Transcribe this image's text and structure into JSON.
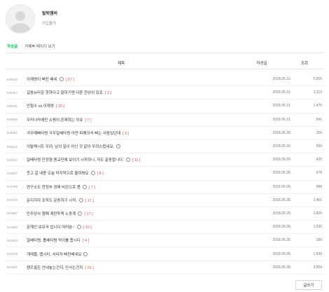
{
  "profile": {
    "name": "탈퇴멤버",
    "status": "가입불가"
  },
  "tabs": [
    {
      "label": "작성글",
      "active": true
    },
    {
      "label": "카페북 페이지 보기",
      "active": false
    }
  ],
  "table": {
    "headers": {
      "title": "제목",
      "date": "작성일",
      "views": "조회"
    },
    "rows": [
      {
        "num": "545612",
        "title": "이재명이 삐진 쎄네",
        "comments": "[ 27 ]",
        "emoji": true,
        "date": "2018.05.31.",
        "views": "5,655"
      },
      {
        "num": "545407",
        "title": "길음뉴타운 핫하다고 말하기엔 다른 현상이 있죠",
        "comments": "[ 3 ]",
        "emoji": false,
        "date": "2018.05.31.",
        "views": "2,113"
      },
      {
        "num": "545231",
        "title": "안철수 vs 이재명",
        "comments": "[ 20 ]",
        "emoji": false,
        "date": "2018.05.31.",
        "views": "1,475"
      },
      {
        "num": "544916",
        "title": "우리나라에만 쇼핑이 존재하는 이유",
        "comments": "[ 7 ]",
        "emoji": false,
        "date": "2018.05.31.",
        "views": "541"
      },
      {
        "num": "544451",
        "title": "극우메빠타령 극우일베타령 어떤 피해의식 삐는 사람있던데",
        "comments": "[ 5 ]",
        "emoji": false,
        "date": "2018.05.30.",
        "views": "156"
      },
      {
        "num": "544112",
        "title": "이탈렉시트 우려, 남의 일이 아닌 것 같아 우려스럽네요.",
        "comments": "",
        "emoji": true,
        "date": "2018.05.30.",
        "views": "599"
      },
      {
        "num": "542167",
        "title": "일베타령 단정형 종교단체 보이기 시작하니, 저도 출동합니다.",
        "comments": "[ 11 ]",
        "emoji": true,
        "date": "2018.05.29.",
        "views": "439"
      },
      {
        "num": "541827",
        "title": "웃고 갈 내용 오늘 마지막으로 올려봐요",
        "comments": "[ 8 ]",
        "emoji": true,
        "date": "2018.05.28.",
        "views": "978"
      },
      {
        "num": "541799",
        "title": "연구소도 현정부 경제 비관으로 봄",
        "comments": "[ 7 ]",
        "emoji": true,
        "date": "2018.05.28.",
        "views": "988"
      },
      {
        "num": "541743",
        "title": "문지지자 조작도 운동하기 시작.",
        "comments": "[ 17 ]",
        "emoji": true,
        "date": "2018.05.28.",
        "views": "2,461"
      },
      {
        "num": "541657",
        "title": "민주당사 행패 계란투척 노동계",
        "comments": "[ 17 ]",
        "emoji": true,
        "date": "2018.05.28.",
        "views": "2,836"
      },
      {
        "num": "541563",
        "title": "문재인 보유국 입니다 여러분~",
        "comments": "[ 10 ]",
        "emoji": true,
        "date": "2018.05.28.",
        "views": "1,030"
      },
      {
        "num": "541524",
        "title": "일베타령, 틀베타령 막이를 좁시다",
        "comments": "[ 4 ]",
        "emoji": false,
        "date": "2018.05.28.",
        "views": "189"
      },
      {
        "num": "541319",
        "title": "개래블, 맵시티, 서리자 삐진베네요",
        "comments": "",
        "emoji": true,
        "date": "2018.05.28.",
        "views": "1,939"
      },
      {
        "num": "541201",
        "title": "팬즈필은 안내놓는건지, 안사는건지",
        "comments": "[ 26 ]",
        "emoji": false,
        "date": "2018.05.28.",
        "views": "3,559"
      }
    ]
  },
  "write_button": "글쓰기",
  "colors": {
    "accent": "#03c75a",
    "comment": "#e05656"
  }
}
